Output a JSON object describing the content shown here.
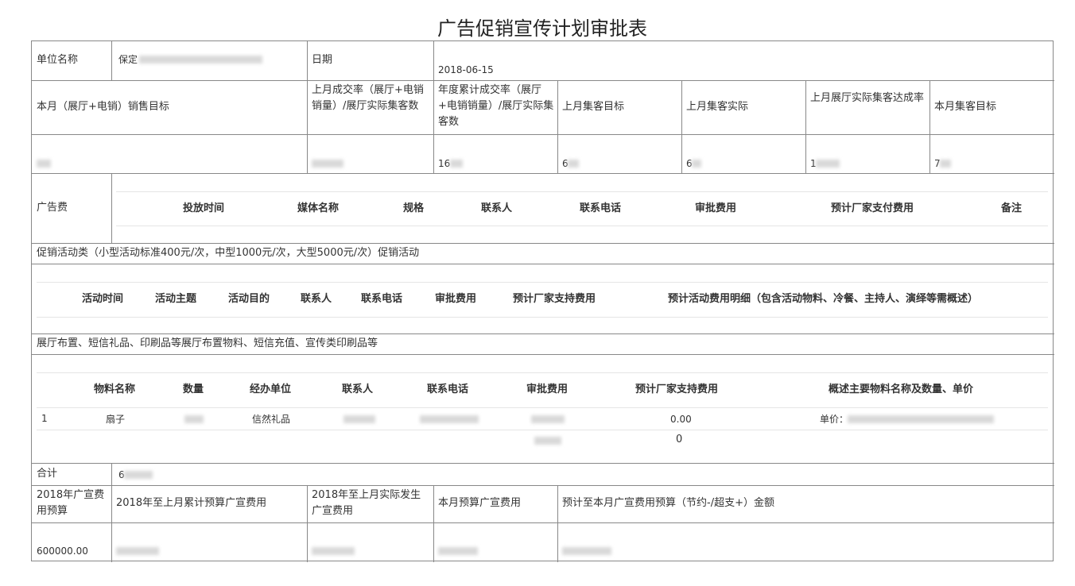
{
  "title": "广告促销宣传计划审批表",
  "header": {
    "unit_label": "单位名称",
    "unit_value": "保定",
    "date_label": "日期",
    "date_value": "2018-06-15"
  },
  "targets": {
    "headers": [
      "本月（展厅+电销）销售目标",
      "上月成交率（展厅+电销销量）/展厅实际集客数",
      "年度累计成交率（展厅+电销销量）/展厅实际集客数",
      "上月集客目标",
      "上月集客实际",
      "上月展厅实际集客达成率",
      "本月集客目标"
    ],
    "values": [
      "",
      "",
      "16",
      "6",
      "6",
      "1",
      "7"
    ]
  },
  "ad_fee": {
    "label": "广告费",
    "headers": [
      "投放时间",
      "媒体名称",
      "规格",
      "联系人",
      "联系电话",
      "审批费用",
      "预计厂家支付费用",
      "备注"
    ]
  },
  "promo": {
    "label": "促销活动类（小型活动标准400元/次，中型1000元/次，大型5000元/次）促销活动",
    "headers": [
      "活动时间",
      "活动主题",
      "活动目的",
      "联系人",
      "联系电话",
      "审批费用",
      "预计厂家支持费用",
      "预计活动费用明细（包含活动物料、冷餐、主持人、演绎等需概述）"
    ]
  },
  "materials": {
    "label": "展厅布置、短信礼品、印刷品等展厅布置物料、短信充值、宣传类印刷品等",
    "headers": [
      "物料名称",
      "数量",
      "经办单位",
      "联系人",
      "联系电话",
      "审批费用",
      "预计厂家支持费用",
      "概述主要物料名称及数量、单价"
    ],
    "row": {
      "index": "1",
      "name": "扇子",
      "unit": "信然礼品",
      "contact": "",
      "support": "0.00",
      "desc_prefix": "单价："
    },
    "subtotal_support": "0"
  },
  "total": {
    "label": "合计",
    "value": "6"
  },
  "budget": {
    "headers": [
      "2018年广宣费用预算",
      "2018年至上月累计预算广宣费用",
      "2018年至上月实际发生广宣费用",
      "本月预算广宣费用",
      "预计至本月广宣费用预算（节约-/超支+）金额"
    ],
    "values": [
      "600000.00",
      "",
      "",
      "",
      ""
    ]
  }
}
